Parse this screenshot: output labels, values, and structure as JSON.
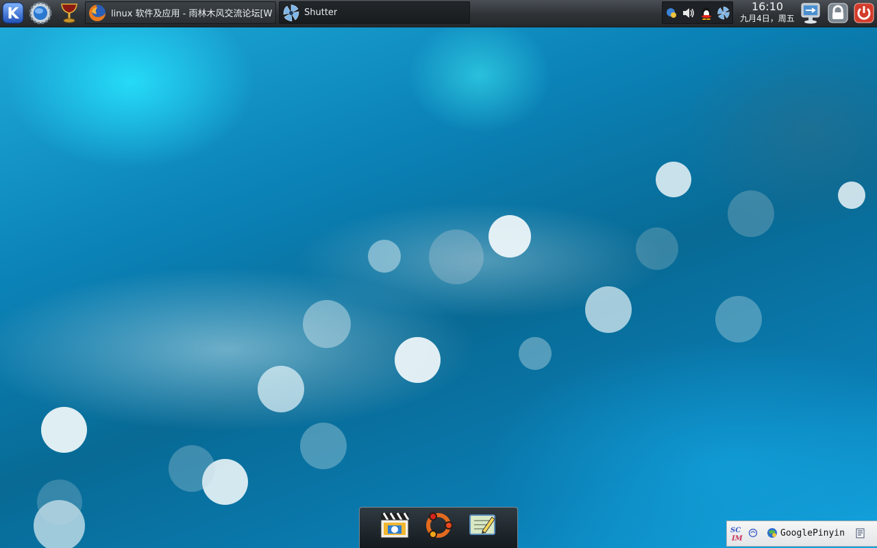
{
  "panel": {
    "launchers": [
      {
        "name": "kde-menu-icon"
      },
      {
        "name": "system-settings-icon"
      },
      {
        "name": "goblet-icon"
      }
    ],
    "tasks": [
      {
        "label": "linux 软件及应用 - 雨林木风交流论坛[W",
        "icon": "firefox-icon"
      },
      {
        "label": "Shutter",
        "icon": "shutter-icon"
      }
    ],
    "tray_icons": [
      "network-icon",
      "volume-icon",
      "qq-penguin-icon",
      "shutter-tray-icon"
    ],
    "clock": {
      "time": "16:10",
      "date": "九月4日，周五"
    },
    "right_buttons": [
      "remote-desktop-icon",
      "lock-icon",
      "power-icon"
    ]
  },
  "dock": {
    "items": [
      "video-player-icon",
      "ubuntu-icon",
      "text-editor-icon"
    ]
  },
  "ime": {
    "logo": "SCIM",
    "engine_label": "GooglePinyin",
    "icons": [
      "scim-logo-icon",
      "input-mode-icon",
      "googlepinyin-icon",
      "menu-icon"
    ]
  },
  "colors": {
    "panel": "#2f3337",
    "wallpaper_accent": "#1ea9d9",
    "power": "#d43b2a"
  }
}
